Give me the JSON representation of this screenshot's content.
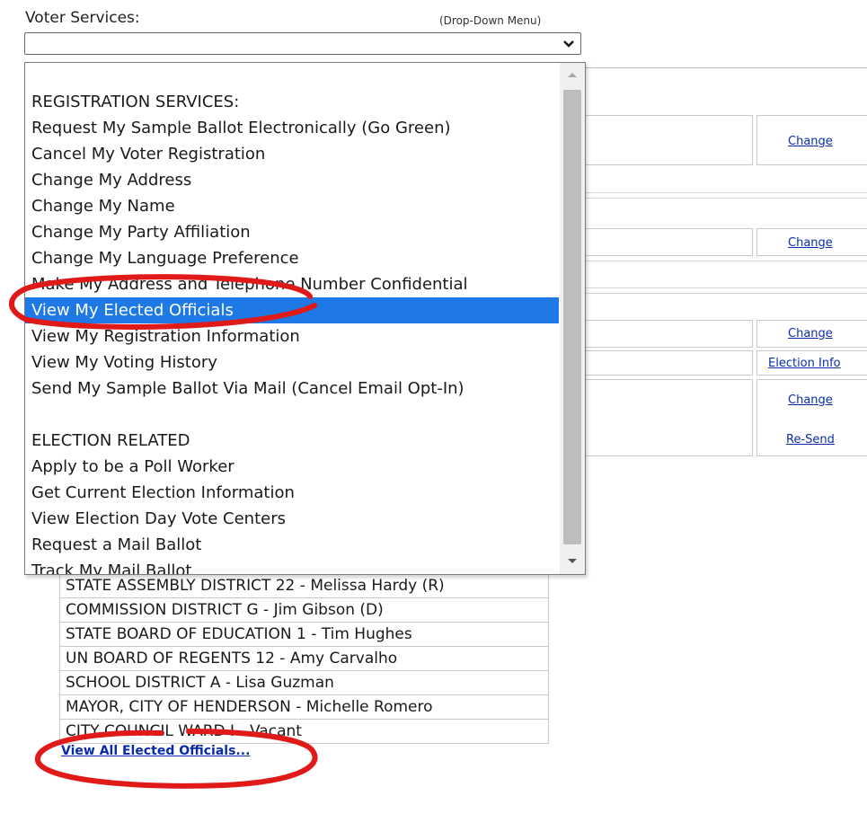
{
  "header": {
    "label": "Voter Services:",
    "dropdown_note": "(Drop-Down Menu)",
    "selected_value": ""
  },
  "dropdown": {
    "options": [
      {
        "label": "",
        "blank": true
      },
      {
        "label": "REGISTRATION SERVICES:"
      },
      {
        "label": "Request My Sample Ballot Electronically (Go Green)"
      },
      {
        "label": "Cancel My Voter Registration"
      },
      {
        "label": "Change My Address"
      },
      {
        "label": "Change My Name"
      },
      {
        "label": "Change My Party Affiliation"
      },
      {
        "label": "Change My Language Preference"
      },
      {
        "label": "Make My Address and Telephone Number Confidential"
      },
      {
        "label": "View My Elected Officials",
        "selected": true
      },
      {
        "label": "View My Registration Information"
      },
      {
        "label": "View My Voting History"
      },
      {
        "label": "Send My Sample Ballot Via Mail (Cancel Email Opt-In)"
      },
      {
        "label": "",
        "blank": true
      },
      {
        "label": "ELECTION RELATED"
      },
      {
        "label": "Apply to be a Poll Worker"
      },
      {
        "label": "Get Current Election Information"
      },
      {
        "label": "View Election Day Vote Centers"
      },
      {
        "label": "Request a Mail Ballot"
      },
      {
        "label": "Track My Mail Ballot"
      }
    ]
  },
  "form_links": {
    "change_1": "Change",
    "change_2": "Change",
    "change_3": "Change",
    "election_info": "Election Info",
    "change_4": "Change",
    "resend": "Re-Send"
  },
  "officials": [
    "STATE ASSEMBLY DISTRICT 22 - Melissa Hardy (R)",
    "COMMISSION DISTRICT G - Jim Gibson (D)",
    "STATE BOARD OF EDUCATION 1 - Tim Hughes",
    "UN BOARD OF REGENTS 12 - Amy Carvalho",
    "SCHOOL DISTRICT A - Lisa Guzman",
    "MAYOR, CITY OF HENDERSON - Michelle Romero",
    "CITY COUNCIL WARD I - Vacant"
  ],
  "view_all_link": "View All Elected Officials...",
  "colors": {
    "selection": "#1e78e6",
    "link": "#0a2ca8",
    "annotation": "#e01919"
  }
}
